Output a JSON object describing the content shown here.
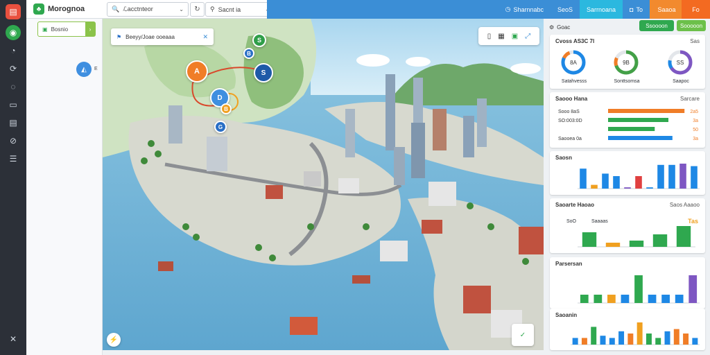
{
  "topbar": {
    "brand": "Morognoa",
    "select1": {
      "value": "ℒacctnteor"
    },
    "select2": {
      "value": "Sacnt ia"
    },
    "segments": [
      {
        "label": "Sharnnabc"
      },
      {
        "label": "SeoS"
      },
      {
        "label": "Sarrnoana"
      },
      {
        "label": "To"
      },
      {
        "label": "Saaoa"
      },
      {
        "label": "Fo"
      }
    ]
  },
  "rail": {
    "logo": "▤",
    "icons": [
      "compass-icon",
      "dashboard-icon",
      "route-icon",
      "globe-icon",
      "layers-icon",
      "chart-icon",
      "link-icon",
      "list-icon"
    ]
  },
  "left_panel": {
    "field_label": "Bosnio",
    "pin_label": "E"
  },
  "map": {
    "card_label": "Beeyy/Joae ooeaaa",
    "pins": [
      {
        "label": "S",
        "color": "#2f9e49"
      },
      {
        "label": "B",
        "color": "#2a6fc6"
      },
      {
        "label": "A",
        "color": "#f07d27"
      },
      {
        "label": "S",
        "color": "#1e5aa8"
      },
      {
        "label": "D",
        "color": "#3f8fe0"
      },
      {
        "label": "B",
        "color": "#f0a020"
      },
      {
        "label": "G",
        "color": "#2a6fc6"
      }
    ]
  },
  "right_panel": {
    "header": "Goac",
    "btn_green": "Ssoooon",
    "btn_lime": "Sooooon",
    "kpi_title": "Cvoss AS3C 7l",
    "kpi_right": "Sas",
    "gauges": [
      {
        "value": "8A",
        "label": "Satahvesss",
        "color": "#1e88e5",
        "accent": "#f07d27",
        "fraction": 0.82
      },
      {
        "value": "9B",
        "label": "Sonttsomsa",
        "color": "#43a047",
        "accent": "#f07d27",
        "fraction": 0.7
      },
      {
        "value": "SS",
        "label": "Saapoc",
        "color": "#7e57c2",
        "accent": "#1e88e5",
        "fraction": 0.66
      }
    ],
    "status": {
      "title": "Saooo Hana",
      "right": "Sarcare",
      "rows": [
        {
          "label": "Sooo 8aS",
          "value": "2a5",
          "color": "#f07d27",
          "fraction": 0.95
        },
        {
          "label": "SO:003:0D",
          "value": "3a",
          "color": "#2fa84f",
          "fraction": 0.75
        },
        {
          "label": "",
          "value": "50",
          "color": "#2fa84f",
          "fraction": 0.58
        },
        {
          "label": "Saooea 0a",
          "value": "3a",
          "color": "#1e88e5",
          "fraction": 0.8
        }
      ]
    },
    "bar1": {
      "title": "Saosn",
      "chart_data": {
        "type": "bar",
        "values": [
          1.6,
          0.3,
          1.2,
          1.0,
          0.1,
          1.0,
          0.1,
          1.9,
          1.9,
          2.0,
          1.8
        ],
        "colors": [
          "#1e88e5",
          "#f0a020",
          "#1e88e5",
          "#1e88e5",
          "#7e57c2",
          "#e04040",
          "#1e88e5",
          "#1e88e5",
          "#1e88e5",
          "#7e57c2",
          "#1e88e5"
        ],
        "ylim": [
          0,
          2
        ]
      }
    },
    "bar2": {
      "title": "Saoarte Haoao",
      "right": "Saos Aaaoo",
      "left_label": "SoO",
      "mid_label": "Saaaas",
      "right_value": "Tas",
      "chart_data": {
        "type": "bar",
        "values": [
          0.7,
          0.2,
          0.3,
          0.6,
          1.0
        ],
        "colors": [
          "#2fa84f",
          "#f0a020",
          "#2fa84f",
          "#2fa84f",
          "#2fa84f"
        ],
        "ylim": [
          0,
          1
        ]
      }
    },
    "bar3": {
      "title": "Parsersan",
      "chart_data": {
        "type": "bar",
        "values": [
          0.3,
          0.3,
          0.3,
          0.3,
          1.0,
          0.3,
          0.3,
          0.3,
          1.0
        ],
        "colors": [
          "#2fa84f",
          "#2fa84f",
          "#f0a020",
          "#1e88e5",
          "#2fa84f",
          "#1e88e5",
          "#1e88e5",
          "#1e88e5",
          "#7e57c2"
        ],
        "ylim": [
          0,
          1
        ]
      }
    },
    "bar4": {
      "title": "Saoanin",
      "chart_data": {
        "type": "bar",
        "values": [
          0.3,
          0.3,
          0.8,
          0.4,
          0.3,
          0.6,
          0.5,
          1.0,
          0.5,
          0.3,
          0.6,
          0.7,
          0.5,
          0.3
        ],
        "colors": [
          "#1e88e5",
          "#f07d27",
          "#2fa84f",
          "#1e88e5",
          "#1e88e5",
          "#1e88e5",
          "#f07d27",
          "#f0a020",
          "#2fa84f",
          "#2fa84f",
          "#1e88e5",
          "#f07d27",
          "#f07d27",
          "#1e88e5"
        ],
        "ylim": [
          0,
          1
        ]
      }
    }
  }
}
